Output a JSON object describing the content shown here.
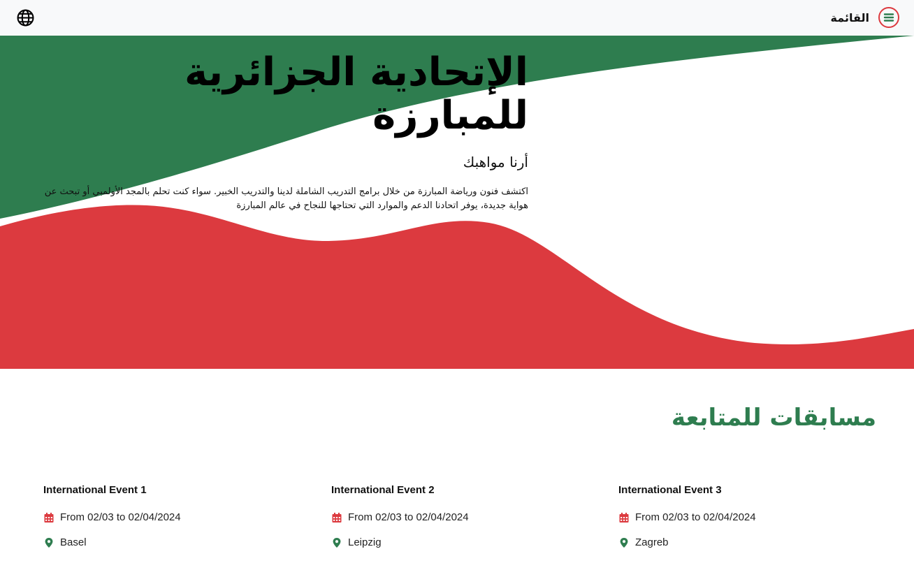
{
  "header": {
    "menu_label": "القائمة",
    "globe_icon": "globe-icon",
    "menu_icon": "hamburger-circle-icon"
  },
  "hero": {
    "title_line1": "الإتحادية الجزائرية",
    "title_line2": "للمبارزة",
    "subtitle": "أرنا مواهبك",
    "description": "اكتشف فنون ورياضة المبارزة من خلال برامج التدريب الشاملة لدينا والتدريب الخبير. سواء كنت تحلم بالمجد الأولمبي أو تبحث عن هواية جديدة، يوفر اتحادنا الدعم والموارد التي تحتاجها للنجاح في عالم المبارزة"
  },
  "section": {
    "title": "مسابقات للمتابعة"
  },
  "events": [
    {
      "name": "International Event 1",
      "date": "From 02/03 to 02/04/2024",
      "location": "Basel"
    },
    {
      "name": "International Event 2",
      "date": "From 02/03 to 02/04/2024",
      "location": "Leipzig"
    },
    {
      "name": "International Event 3",
      "date": "From 02/03 to 02/04/2024",
      "location": "Zagreb"
    }
  ],
  "colors": {
    "green": "#2e7d4f",
    "red": "#dc3a3f",
    "topbar_bg": "#f8f9fa"
  }
}
